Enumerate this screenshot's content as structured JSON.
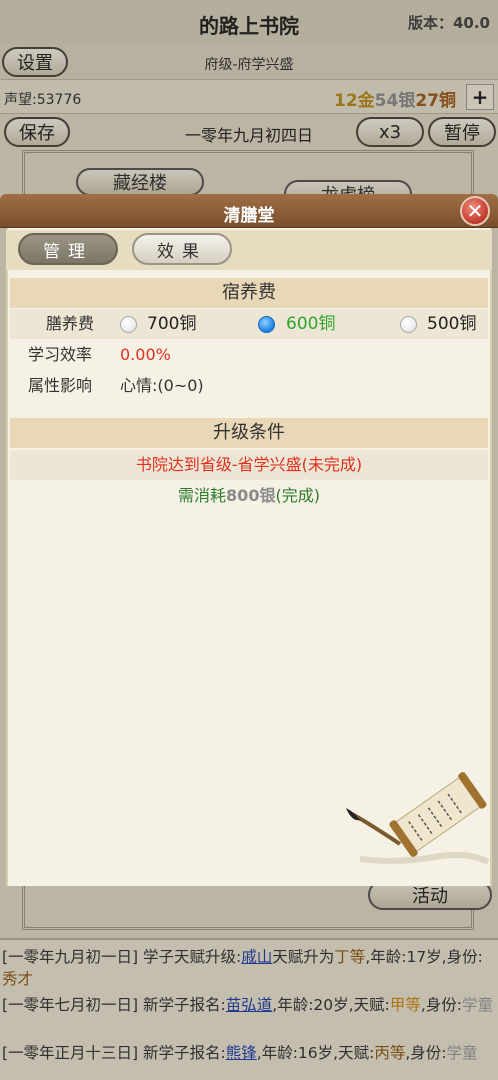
{
  "app": {
    "title": "的路上书院",
    "version": "版本：40.0"
  },
  "header": {
    "settings_label": "设置",
    "rank_text": "府级-府学兴盛",
    "prestige": "声望:53776",
    "money": {
      "gold": "12金",
      "silver": "54银",
      "copper": "27铜"
    },
    "plus_label": "+",
    "save_label": "保存",
    "date": "一零年九月初四日",
    "speed_label": "x3",
    "pause_label": "暂停"
  },
  "buildings": {
    "sutra": "藏经楼",
    "dragon": "龙虎榜"
  },
  "activity_label": "活动",
  "modal": {
    "title": "清膳堂",
    "close_icon": "close-icon",
    "tabs": {
      "manage": "管理",
      "effect": "效果"
    },
    "boarding": {
      "section_title": "宿养费",
      "fee_label": "膳养费",
      "options": [
        "700铜",
        "600铜",
        "500铜"
      ],
      "selected": "600铜",
      "efficiency_label": "学习效率",
      "efficiency_value": "0.00%",
      "attr_label": "属性影响",
      "attr_value": "心情:(0~0)"
    },
    "upgrade": {
      "section_title": "升级条件",
      "cond1": "书院达到省级-省学兴盛(未完成)",
      "cond2_prefix": "需消耗",
      "cond2_amount": "800银",
      "cond2_suffix": "(完成)"
    }
  },
  "log": [
    {
      "date": "[一零年九月初一日]",
      "text1": " 学子天赋升级:",
      "name": "戚山",
      "text2": "天赋升为",
      "grade": "丁等",
      "text3": ",年龄:17岁,身份:",
      "status": "秀才"
    },
    {
      "date": "[一零年七月初一日]",
      "text1": " 新学子报名:",
      "name": "苗弘道",
      "text2": ",年龄:20岁,天赋:",
      "grade": "甲等",
      "text3": ",身份:",
      "status": "学童"
    },
    {
      "date": "[一零年正月十三日]",
      "text1": " 新学子报名:",
      "name": "熊锋",
      "text2": ",年龄:16岁,天赋:",
      "grade": "丙等",
      "text3": ",身份:",
      "status": "学童"
    }
  ],
  "colors": {
    "header_brown": "#8c5e38",
    "selected_green": "#2fa52f",
    "red_text": "#e03020",
    "section_bg": "#e9d8b8"
  }
}
